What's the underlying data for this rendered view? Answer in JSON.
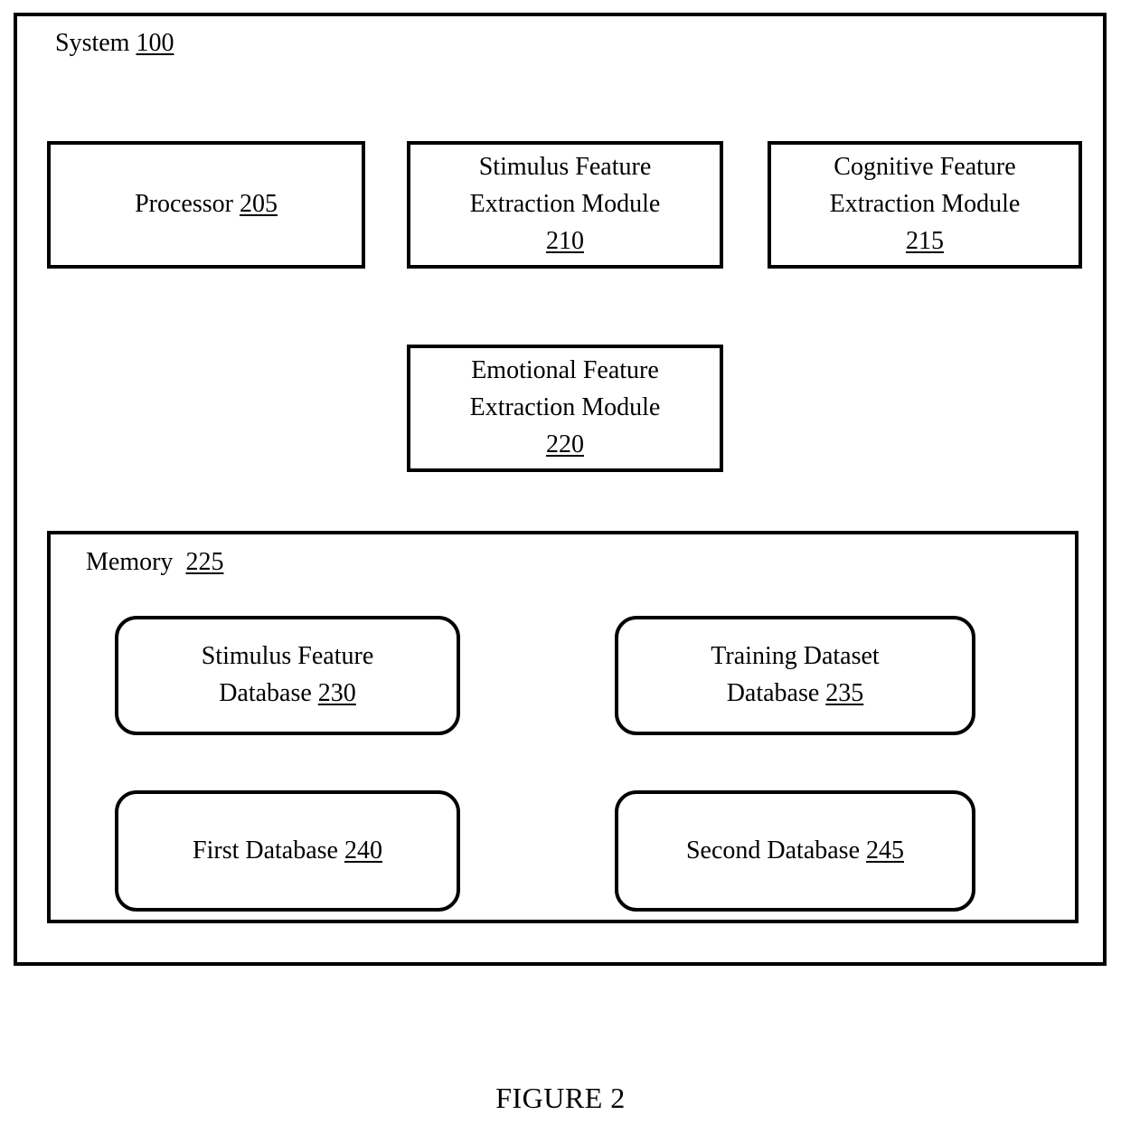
{
  "figure": {
    "caption": "FIGURE 2"
  },
  "system": {
    "label": "System",
    "ref": "100"
  },
  "modules": [
    {
      "id": "processor",
      "name": "Processor",
      "lines": "Processor ",
      "ref": "205"
    },
    {
      "id": "stimulus-feature-extraction-module",
      "name": "Stimulus Feature Extraction Module",
      "lines": "Stimulus Feature\nExtraction Module\n",
      "ref": "210"
    },
    {
      "id": "cognitive-feature-extraction-module",
      "name": "Cognitive Feature Extraction Module",
      "lines": "Cognitive Feature\nExtraction Module\n",
      "ref": "215"
    },
    {
      "id": "emotional-feature-extraction-module",
      "name": "Emotional Feature Extraction Module",
      "lines": "Emotional Feature\nExtraction Module\n",
      "ref": "220"
    }
  ],
  "memory": {
    "label": "Memory  ",
    "ref": "225",
    "databases": [
      {
        "id": "stimulus-feature-database",
        "name": "Stimulus Feature Database",
        "lines": "Stimulus Feature\nDatabase ",
        "ref": "230"
      },
      {
        "id": "training-dataset-database",
        "name": "Training Dataset Database",
        "lines": "Training Dataset\nDatabase ",
        "ref": "235"
      },
      {
        "id": "first-database",
        "name": "First Database",
        "lines": "First Database ",
        "ref": "240"
      },
      {
        "id": "second-database",
        "name": "Second Database",
        "lines": "Second Database ",
        "ref": "245"
      }
    ]
  },
  "colors": {
    "stroke": "#000000",
    "background": "#ffffff",
    "text": "#000000"
  }
}
